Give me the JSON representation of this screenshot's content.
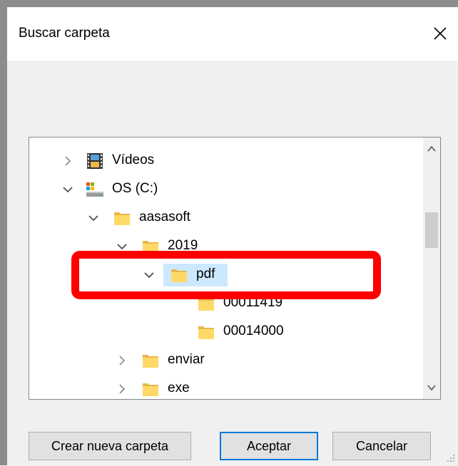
{
  "dialog": {
    "title": "Buscar carpeta",
    "close_icon": "close-icon"
  },
  "tree": {
    "items": [
      {
        "label": "Vídeos",
        "expanded": false,
        "icon": "videos-folder-icon"
      },
      {
        "label": "OS (C:)",
        "expanded": true,
        "icon": "drive-icon"
      },
      {
        "label": "aasasoft",
        "expanded": true,
        "icon": "folder-icon"
      },
      {
        "label": "2019",
        "expanded": true,
        "icon": "folder-icon"
      },
      {
        "label": "pdf",
        "expanded": true,
        "selected": true,
        "icon": "folder-icon"
      },
      {
        "label": "00011419",
        "icon": "folder-icon"
      },
      {
        "label": "00014000",
        "icon": "folder-icon"
      },
      {
        "label": "enviar",
        "expanded": false,
        "icon": "folder-icon"
      },
      {
        "label": "exe",
        "expanded": false,
        "icon": "folder-icon"
      }
    ]
  },
  "buttons": {
    "new_folder": "Crear nueva carpeta",
    "accept": "Aceptar",
    "cancel": "Cancelar"
  },
  "colors": {
    "selection": "#cce8ff",
    "highlight": "#ff0000",
    "folder": "#ffd966",
    "default_button_border": "#0078d7"
  }
}
